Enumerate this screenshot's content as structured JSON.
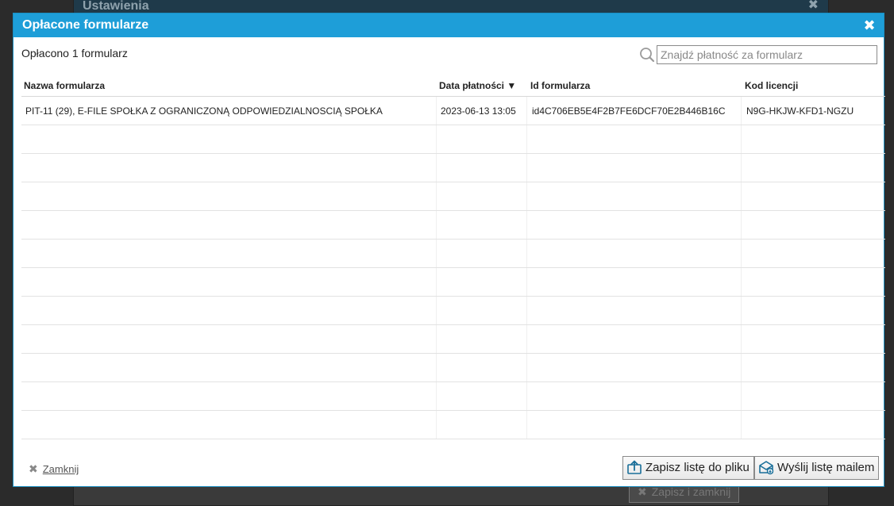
{
  "background": {
    "window_title": "Ustawienia",
    "close_symbol": "✖",
    "save_close_button": "Zapisz i zamknij"
  },
  "modal": {
    "title": "Opłacone formularze",
    "close_symbol": "✖",
    "summary": "Opłacono 1 formularz",
    "search_placeholder": "Znajdź płatność za formularz",
    "columns": {
      "name": "Nazwa formularza",
      "date": "Data płatności ▼",
      "id": "Id formularza",
      "license": "Kod licencji"
    },
    "rows": [
      {
        "name": "PIT-11 (29), E-FILE SPOŁKA Z OGRANICZONĄ ODPOWIEDZIALNOSCIĄ SPOŁKA",
        "date": "2023-06-13 13:05",
        "id": "id4C706EB5E4F2B7FE6DCF70E2B446B16C",
        "license": "N9G-HKJW-KFD1-NGZU"
      }
    ],
    "empty_rows": 11,
    "footer": {
      "close_link": "Zamknij",
      "close_symbol": "✖",
      "save_button": "Zapisz listę do pliku",
      "mail_button": "Wyślij listę mailem"
    }
  },
  "colors": {
    "header_bg": "#1e9ed8",
    "header_text": "#ffffff",
    "icon_accent": "#1a6f99"
  }
}
